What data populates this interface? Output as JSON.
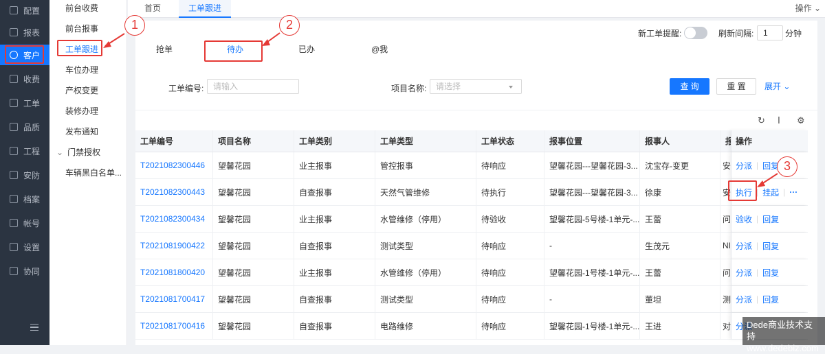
{
  "sidebar": {
    "items": [
      {
        "label": "配置",
        "icon": "gear-icon"
      },
      {
        "label": "报表",
        "icon": "report-icon"
      },
      {
        "label": "客户",
        "icon": "user-icon"
      },
      {
        "label": "收费",
        "icon": "wallet-icon"
      },
      {
        "label": "工单",
        "icon": "clipboard-icon"
      },
      {
        "label": "品质",
        "icon": "quality-icon"
      },
      {
        "label": "工程",
        "icon": "engineering-icon"
      },
      {
        "label": "安防",
        "icon": "security-icon"
      },
      {
        "label": "档案",
        "icon": "archive-icon"
      },
      {
        "label": "帐号",
        "icon": "account-icon"
      },
      {
        "label": "设置",
        "icon": "settings-icon"
      },
      {
        "label": "协同",
        "icon": "collaboration-icon"
      }
    ]
  },
  "submenu": {
    "items": [
      {
        "label": "前台收费"
      },
      {
        "label": "前台报事"
      },
      {
        "label": "工单跟进"
      },
      {
        "label": "车位办理"
      },
      {
        "label": "产权变更"
      },
      {
        "label": "装修办理"
      },
      {
        "label": "发布通知"
      },
      {
        "label": "门禁授权",
        "caret": "⌄"
      },
      {
        "label": "车辆黑白名单..."
      }
    ]
  },
  "tabs": {
    "items": [
      {
        "label": "首页"
      },
      {
        "label": "工单跟进"
      }
    ],
    "ops_label": "操作",
    "ops_caret": "⌄"
  },
  "subtabs": [
    {
      "label": "抢单"
    },
    {
      "label": "待办"
    },
    {
      "label": "已办"
    },
    {
      "label": "@我"
    }
  ],
  "settings": {
    "new_order_reminder_label": "新工单提醒:",
    "refresh_label": "刷新间隔:",
    "refresh_value": "1",
    "refresh_unit": "分钟"
  },
  "search": {
    "order_no_label": "工单编号:",
    "order_no_placeholder": "请输入",
    "project_label": "项目名称:",
    "project_placeholder": "请选择",
    "query_button": "查 询",
    "reset_button": "重 置",
    "expand_label": "展开"
  },
  "table": {
    "columns": [
      "工单编号",
      "项目名称",
      "工单类别",
      "工单类型",
      "工单状态",
      "报事位置",
      "报事人",
      "报",
      "操作"
    ],
    "rows": [
      {
        "order_no": "T2021082300446",
        "project": "望馨花园",
        "category": "业主报事",
        "type": "管控报事",
        "status": "待响应",
        "location": "望馨花园---望馨花园-3...",
        "reporter": "沈宝存-变更",
        "extra": "安",
        "actions": [
          "分派",
          "回复"
        ]
      },
      {
        "order_no": "T2021082300443",
        "project": "望馨花园",
        "category": "自查报事",
        "type": "天然气管维修",
        "status": "待执行",
        "location": "望馨花园---望馨花园-3...",
        "reporter": "徐康",
        "extra": "安",
        "actions": [
          "执行",
          "挂起"
        ]
      },
      {
        "order_no": "T2021082300434",
        "project": "望馨花园",
        "category": "业主报事",
        "type": "水管维修（停用）",
        "status": "待验收",
        "location": "望馨花园-5号楼-1单元-...",
        "reporter": "王蕾",
        "extra": "问",
        "actions": [
          "验收",
          "回复"
        ]
      },
      {
        "order_no": "T2021081900422",
        "project": "望馨花园",
        "category": "自查报事",
        "type": "测试类型",
        "status": "待响应",
        "location": "-",
        "reporter": "生茂元",
        "extra": "NI",
        "actions": [
          "分派",
          "回复"
        ]
      },
      {
        "order_no": "T2021081800420",
        "project": "望馨花园",
        "category": "业主报事",
        "type": "水管维修（停用）",
        "status": "待响应",
        "location": "望馨花园-1号楼-1单元-...",
        "reporter": "王蕾",
        "extra": "问",
        "actions": [
          "分派",
          "回复"
        ]
      },
      {
        "order_no": "T2021081700417",
        "project": "望馨花园",
        "category": "自查报事",
        "type": "测试类型",
        "status": "待响应",
        "location": "-",
        "reporter": "董坦",
        "extra": "测",
        "actions": [
          "分派",
          "回复"
        ]
      },
      {
        "order_no": "T2021081700416",
        "project": "望馨花园",
        "category": "自查报事",
        "type": "电路维修",
        "status": "待响应",
        "location": "望馨花园-1号楼-1单元-...",
        "reporter": "王进",
        "extra": "对",
        "actions": [
          "分派",
          ""
        ]
      }
    ],
    "more_glyph": "···"
  },
  "callouts": [
    "1",
    "2",
    "3"
  ],
  "watermark": {
    "line1": "Dede商业技术支持",
    "line2": "www.dedebiz.com"
  },
  "colors": {
    "accent": "#1677ff",
    "sidebar_bg": "#2b3441",
    "annotation": "#e53935"
  }
}
